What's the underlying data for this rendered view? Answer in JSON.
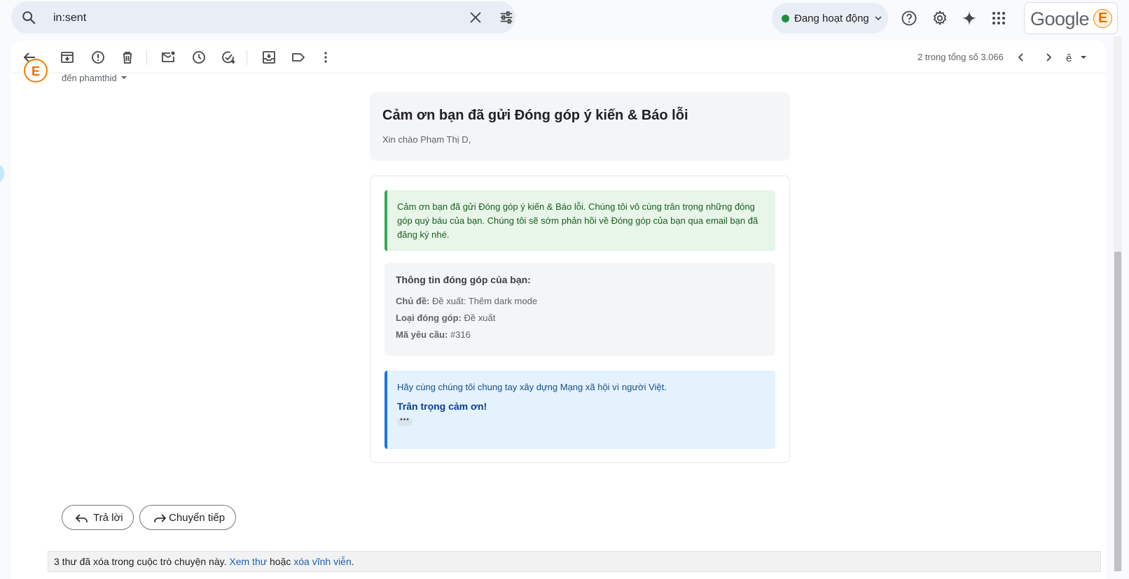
{
  "search": {
    "value": "in:sent",
    "placeholder": ""
  },
  "status": {
    "label": "Đang hoạt động"
  },
  "account": {
    "logo_text": "Google",
    "avatar_letter": "E"
  },
  "pagination": {
    "label": "2 trong tổng số 3.066"
  },
  "message": {
    "to_label": "đến phamthid",
    "sender_avatar_letter": "E",
    "title": "Cảm ơn bạn đã gửi Đóng góp ý kiến & Báo lỗi",
    "greeting": "Xin chào Phạm Thị D,",
    "thanks_note": "Cảm ơn bạn đã gửi Đóng góp ý kiến & Báo lỗi. Chúng tôi vô cùng trân trọng những đóng góp quý báu của bạn. Chúng tôi sẽ sớm phản hồi về Đóng góp của bạn qua email bạn đã đăng ký nhé.",
    "info": {
      "heading": "Thông tin đóng góp của bạn:",
      "subject_label": "Chủ đề:",
      "subject_value": "Đề xuất: Thêm dark mode",
      "type_label": "Loại đóng góp:",
      "type_value": "Đề xuất",
      "id_label": "Mã yêu cầu:",
      "id_value": "#316"
    },
    "closing": "Hãy cùng chúng tôi chung tay xây dựng Mạng xã hội vì người Việt.",
    "signoff": "Trân trọng cảm ơn!",
    "more_label": "•••"
  },
  "actions": {
    "reply": "Trả lời",
    "forward": "Chuyển tiếp"
  },
  "deleted_notice": {
    "prefix": "3 thư đã xóa trong cuộc trò chuyện này.",
    "view_link": "Xem thư",
    "or": "hoặc",
    "delete_link": "xóa vĩnh viễn",
    "suffix": "."
  },
  "colors": {
    "accent_green": "#34a853",
    "accent_blue": "#1a73e8",
    "status_dot": "#1e8e3e",
    "avatar_orange": "#ef6c00"
  }
}
